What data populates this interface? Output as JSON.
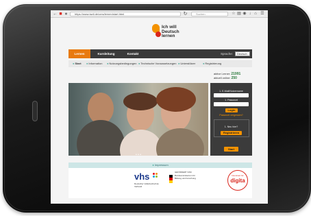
{
  "browser": {
    "url": "https://www.iwdl.de/cms/lernen/start.html",
    "search_placeholder": "Suchen",
    "back_icon": "back-arrow-icon",
    "reload_icon": "reload-icon"
  },
  "site": {
    "logo_text": [
      "Ich will",
      "Deutsch",
      "lernen"
    ],
    "nav": [
      "Lernen",
      "Kursleitung",
      "Kontakt"
    ],
    "language_label": "Sprache:",
    "language_value": "Deutsch",
    "subnav": [
      "Start",
      "Information",
      "Nutzungsbedingungen",
      "Technische Voraussetzungen",
      "Unterstützer",
      "Registrierung"
    ],
    "online_users": {
      "label1": "aktive Lerner:",
      "count1": "21991",
      "label2": "aktuell online:",
      "count2": "250"
    },
    "login": {
      "email_label": "1. E-Mail/Nutzername",
      "password_label": "1. Passwort",
      "login_button": "Login",
      "forgot": "Passwort vergessen?",
      "new_label": "1. Neu hier?",
      "register_button": "Registrieren",
      "start_button": "Start"
    },
    "info_bar": "Impressum",
    "partners": {
      "vhs": "vhs",
      "vhs_sub": "Deutscher Volkshochschul-Verband",
      "ministry_title": "Bundesministerium für Bildung und Forschung",
      "ministry_prefix": "GEFÖRDERT VOM",
      "badge": "digita",
      "badge_sub": "Nominiert für"
    }
  },
  "colors": {
    "accent": "#f39200",
    "nav_bg": "#3a3a3a",
    "info_bar": "#cde6e6"
  }
}
